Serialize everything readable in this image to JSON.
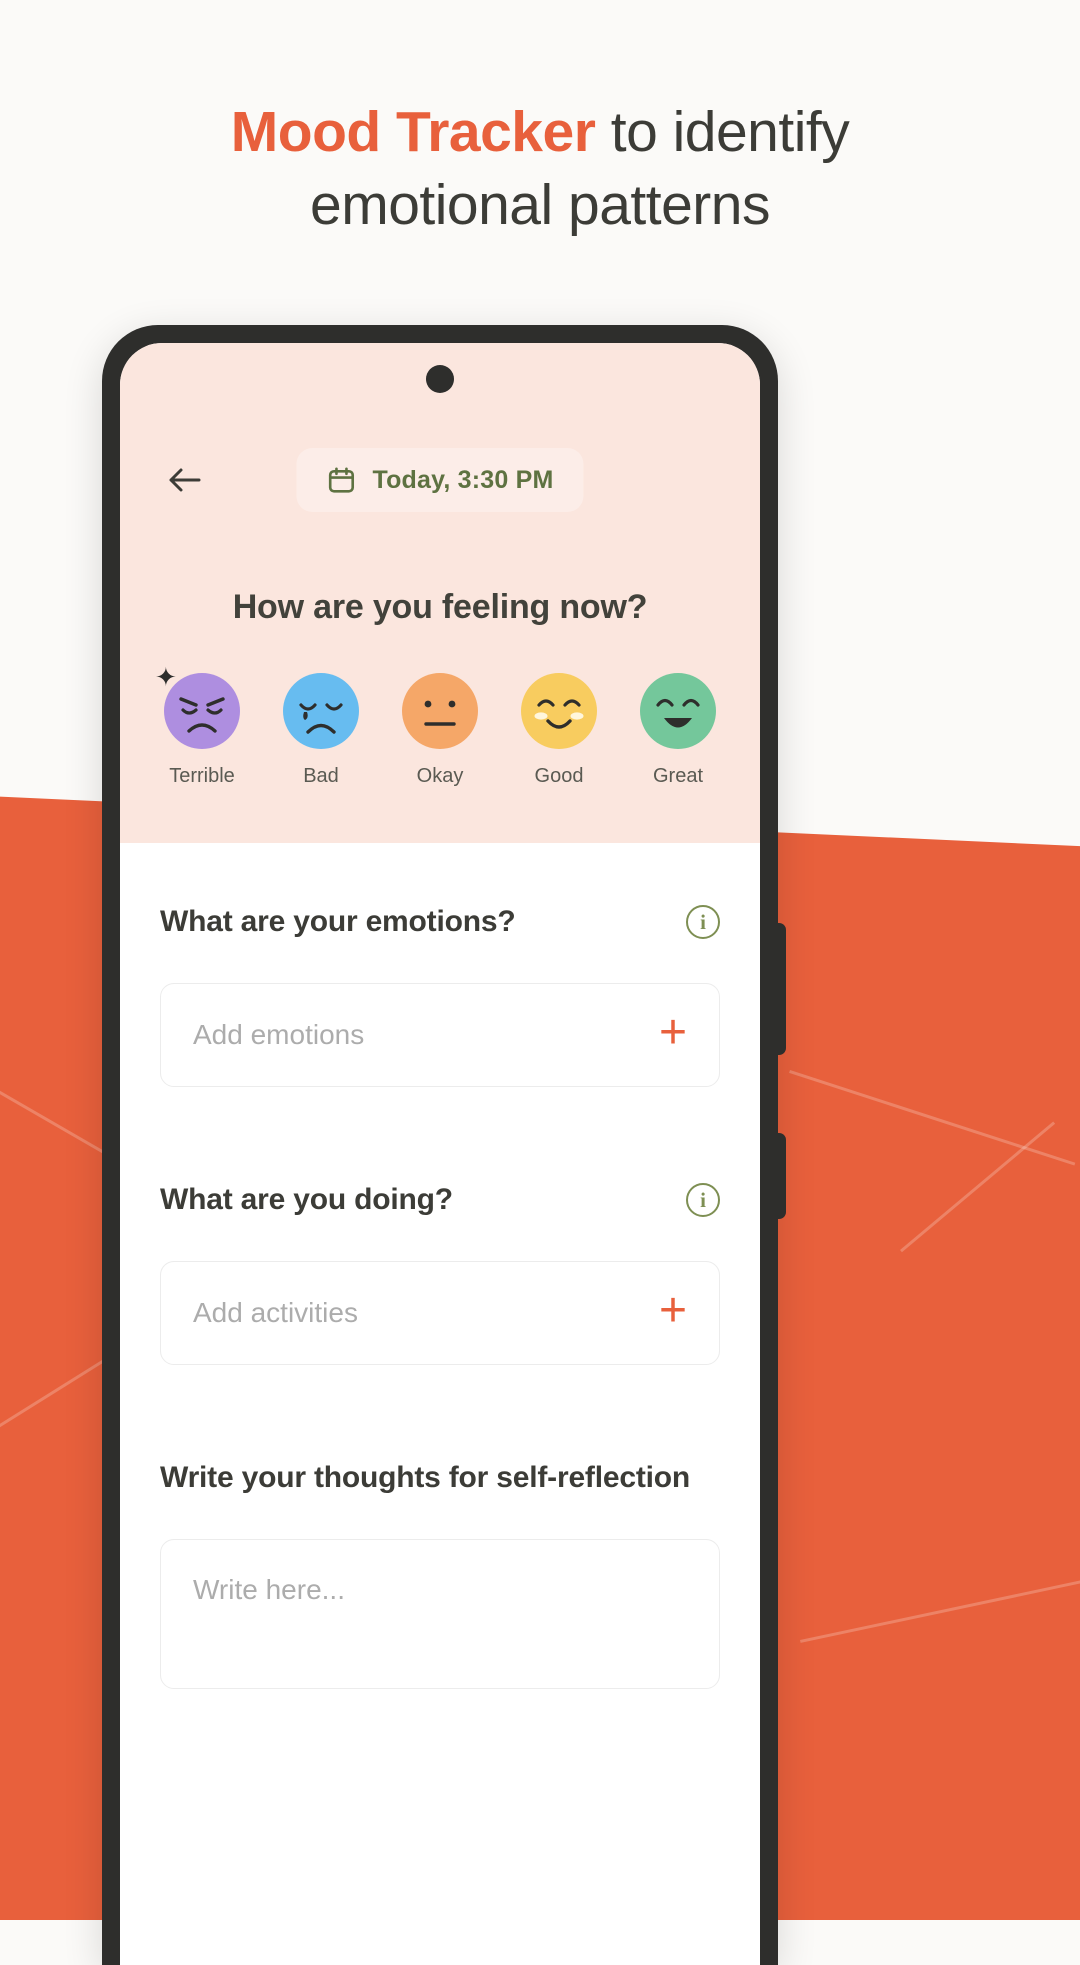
{
  "headline": {
    "accent": "Mood Tracker",
    "rest": " to identify",
    "line2": "emotional patterns"
  },
  "colors": {
    "accent_orange": "#E8603C",
    "pink_header": "#FBE6DE",
    "text_dark": "#3C3C37",
    "date_green": "#5E7241",
    "info_green": "#7E8F53",
    "placeholder_gray": "#ACACAC",
    "phone_frame": "#2E2E2C"
  },
  "screen": {
    "topbar": {
      "back_icon": "arrow-left-icon",
      "calendar_icon": "calendar-icon",
      "date_text": "Today, 3:30 PM"
    },
    "question": "How are you feeling now?",
    "moods": [
      {
        "label": "Terrible",
        "color": "#AE8EE0",
        "face": "angry-face",
        "spark": "✦"
      },
      {
        "label": "Bad",
        "color": "#67BCF0",
        "face": "sad-crying-face",
        "spark": ""
      },
      {
        "label": "Okay",
        "color": "#F5A768",
        "face": "neutral-face",
        "spark": ""
      },
      {
        "label": "Good",
        "color": "#F8CC5F",
        "face": "smiling-blush-face",
        "spark": ""
      },
      {
        "label": "Great",
        "color": "#74C79B",
        "face": "grinning-face",
        "spark": ""
      }
    ],
    "sections": [
      {
        "title": "What are your emotions?",
        "info": "i",
        "placeholder": "Add emotions",
        "add": "+"
      },
      {
        "title": "What are you doing?",
        "info": "i",
        "placeholder": "Add activities",
        "add": "+"
      }
    ],
    "reflection": {
      "title": "Write your thoughts for self-reflection",
      "placeholder": "Write here..."
    }
  }
}
